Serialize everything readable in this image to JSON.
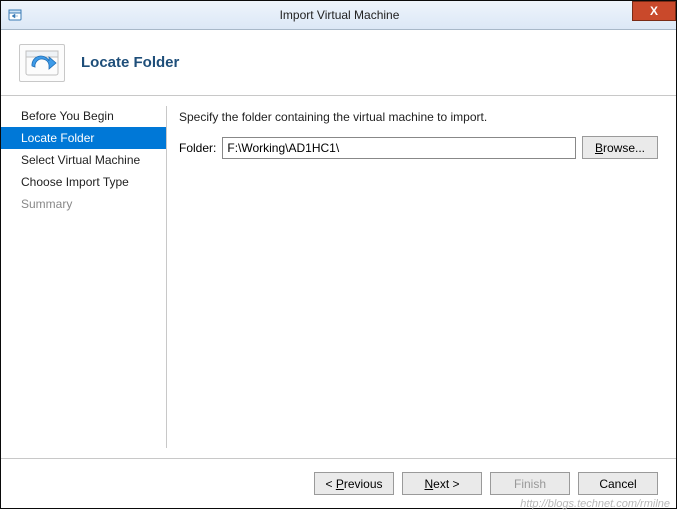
{
  "window": {
    "title": "Import Virtual Machine",
    "close_label": "X"
  },
  "header": {
    "heading": "Locate Folder"
  },
  "sidebar": {
    "items": [
      {
        "label": "Before You Begin",
        "state": "normal"
      },
      {
        "label": "Locate Folder",
        "state": "active"
      },
      {
        "label": "Select Virtual Machine",
        "state": "normal"
      },
      {
        "label": "Choose Import Type",
        "state": "normal"
      },
      {
        "label": "Summary",
        "state": "inactive"
      }
    ]
  },
  "content": {
    "instruction": "Specify the folder containing the virtual machine to import.",
    "folder_label": "Folder:",
    "folder_value": "F:\\Working\\AD1HC1\\",
    "browse_label": "Browse..."
  },
  "footer": {
    "previous": "< Previous",
    "next": "Next >",
    "finish": "Finish",
    "cancel": "Cancel"
  },
  "watermark": "http://blogs.technet.com/rmilne"
}
